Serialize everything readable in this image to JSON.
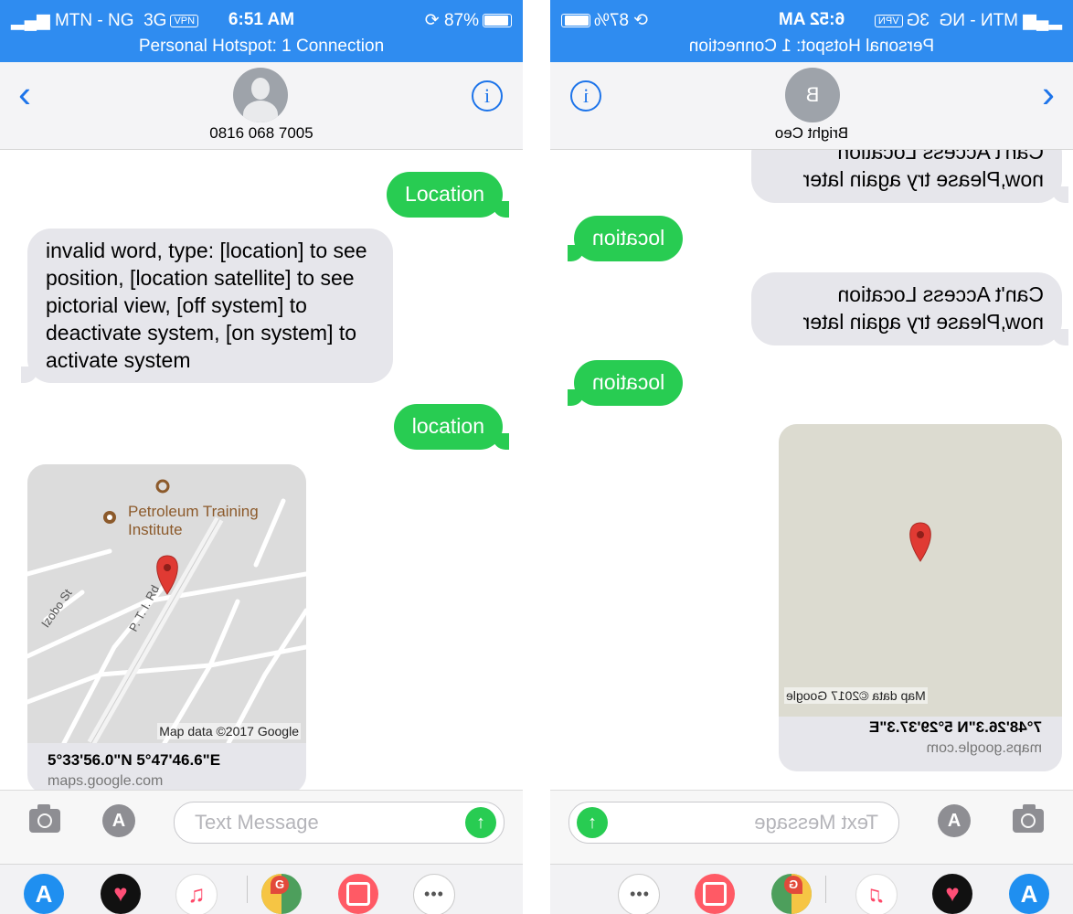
{
  "left_screen": {
    "status": {
      "carrier": "MTN - NG",
      "network": "3G",
      "vpn": "VPN",
      "time": "6:51 AM",
      "battery": "87%",
      "hotspot": "Personal Hotspot: 1 Connection"
    },
    "contact": {
      "name": "0816 068 7005"
    },
    "messages": {
      "m1": "Location",
      "m2": "invalid word, type: [location] to see position, [location satellite] to see pictorial view, [off system] to deactivate system, [on system] to activate system",
      "m3": "location"
    },
    "map": {
      "poi": "Petroleum Training Institute",
      "street1": "Izobo St",
      "street2": "P. T. I. Rd",
      "attribution": "Map data ©2017 Google",
      "coords": "5°33'56.0\"N 5°47'46.6\"E",
      "domain": "maps.google.com"
    },
    "compose": {
      "placeholder": "Text Message"
    }
  },
  "right_screen": {
    "status": {
      "carrier": "MTN - NG",
      "network": "3G",
      "vpn": "VPN",
      "time": "6:52 AM",
      "battery": "87%",
      "hotspot": "Personal Hotspot: 1 Connection"
    },
    "contact": {
      "name": "Bright Ceo",
      "initial": "B"
    },
    "messages": {
      "m1": "Can't Access Location now,Please try again later",
      "m2": "location",
      "m3": "Can't Access Location now,Please try again later",
      "m4": "location"
    },
    "map": {
      "attribution": "Map data ©2017 Google",
      "coords": "7°48'26.3\"N 5°29'37.3\"E",
      "domain": "maps.google.com"
    },
    "compose": {
      "placeholder": "Text Message"
    }
  },
  "icons": {
    "back": "chevron-left-icon",
    "info": "info-icon",
    "camera": "camera-icon",
    "appstore": "appstore-icon",
    "send": "arrow-up-icon",
    "more": "more-icon"
  },
  "colors": {
    "status_bar": "#2f8cf0",
    "outgoing_bubble": "#28cc52",
    "incoming_bubble": "#e6e6eb",
    "link_blue": "#1d74ea"
  }
}
